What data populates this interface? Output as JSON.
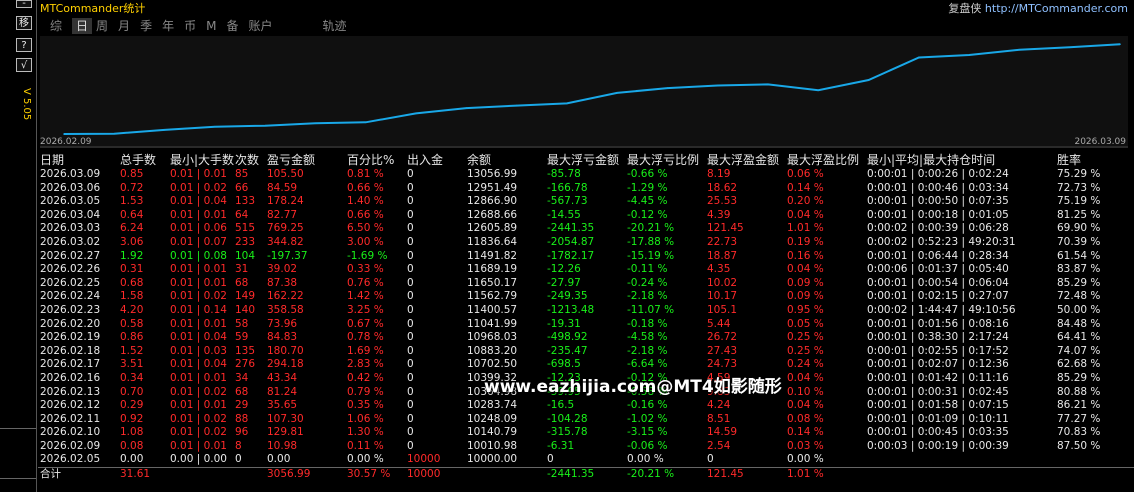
{
  "app": {
    "title": "MTCommander统计",
    "replay_label": "复盘侠",
    "replay_url": "http://MTCommander.com",
    "version": "V 5.05"
  },
  "sidebar_buttons": [
    "-",
    "移",
    "?",
    "√"
  ],
  "tabs": [
    {
      "label": "综",
      "active": false
    },
    {
      "label": "日",
      "active": true
    },
    {
      "label": "周",
      "active": false
    },
    {
      "label": "月",
      "active": false
    },
    {
      "label": "季",
      "active": false
    },
    {
      "label": "年",
      "active": false
    },
    {
      "label": "币",
      "active": false
    },
    {
      "label": "M",
      "active": false
    },
    {
      "label": "备",
      "active": false
    },
    {
      "label": "账户",
      "active": false
    },
    {
      "label": "轨迹",
      "active": false
    }
  ],
  "chart_data": {
    "type": "line",
    "x_start_label": "2026.02.09",
    "x_end_label": "2026.03.09",
    "ylim": [
      10000,
      13200
    ],
    "line_color": "#19a8e8",
    "x": [
      "2026.02.05",
      "2026.02.09",
      "2026.02.10",
      "2026.02.11",
      "2026.02.12",
      "2026.02.13",
      "2026.02.16",
      "2026.02.17",
      "2026.02.18",
      "2026.02.19",
      "2026.02.20",
      "2026.02.23",
      "2026.02.24",
      "2026.02.25",
      "2026.02.26",
      "2026.02.27",
      "2026.03.02",
      "2026.03.03",
      "2026.03.04",
      "2026.03.05",
      "2026.03.06",
      "2026.03.09"
    ],
    "values": [
      10000.0,
      10010.98,
      10140.79,
      10248.09,
      10283.74,
      10364.98,
      10399.32,
      10702.5,
      10883.2,
      10968.03,
      11041.99,
      11400.57,
      11562.79,
      11650.17,
      11689.19,
      11491.82,
      11836.64,
      12605.89,
      12688.66,
      12866.9,
      12951.49,
      13056.99
    ]
  },
  "table": {
    "headers": [
      "日期",
      "总手数",
      "最小|大手数",
      "次数",
      "盈亏金额",
      "百分比%",
      "出入金",
      "余额",
      "最大浮亏金额",
      "最大浮亏比例",
      "最大浮盈金额",
      "最大浮盈比例",
      "最小|平均|最大持仓时间",
      "胜率"
    ],
    "rows": [
      {
        "c": [
          "2026.03.09",
          "0.85",
          "0.01 | 0.01",
          "85",
          "105.50",
          "0.81 %",
          "0",
          "13056.99",
          "-85.78",
          "-0.66 %",
          "8.19",
          "0.06 %",
          "0:00:01 | 0:00:26 | 0:02:24",
          "75.29 %"
        ],
        "loss": false
      },
      {
        "c": [
          "2026.03.06",
          "0.72",
          "0.01 | 0.02",
          "66",
          "84.59",
          "0.66 %",
          "0",
          "12951.49",
          "-166.78",
          "-1.29 %",
          "18.62",
          "0.14 %",
          "0:00:01 | 0:00:46 | 0:03:34",
          "72.73 %"
        ],
        "loss": false
      },
      {
        "c": [
          "2026.03.05",
          "1.53",
          "0.01 | 0.04",
          "133",
          "178.24",
          "1.40 %",
          "0",
          "12866.90",
          "-567.73",
          "-4.45 %",
          "25.53",
          "0.20 %",
          "0:00:01 | 0:00:50 | 0:07:35",
          "75.19 %"
        ],
        "loss": false
      },
      {
        "c": [
          "2026.03.04",
          "0.64",
          "0.01 | 0.01",
          "64",
          "82.77",
          "0.66 %",
          "0",
          "12688.66",
          "-14.55",
          "-0.12 %",
          "4.39",
          "0.04 %",
          "0:00:01 | 0:00:18 | 0:01:05",
          "81.25 %"
        ],
        "loss": false
      },
      {
        "c": [
          "2026.03.03",
          "6.24",
          "0.01 | 0.06",
          "515",
          "769.25",
          "6.50 %",
          "0",
          "12605.89",
          "-2441.35",
          "-20.21 %",
          "121.45",
          "1.01 %",
          "0:00:02 | 0:00:39 | 0:06:28",
          "69.90 %"
        ],
        "loss": false
      },
      {
        "c": [
          "2026.03.02",
          "3.06",
          "0.01 | 0.07",
          "233",
          "344.82",
          "3.00 %",
          "0",
          "11836.64",
          "-2054.87",
          "-17.88 %",
          "22.73",
          "0.19 %",
          "0:00:02 | 0:52:23 | 49:20:31",
          "70.39 %"
        ],
        "loss": false
      },
      {
        "c": [
          "2026.02.27",
          "1.92",
          "0.01 | 0.08",
          "104",
          "-197.37",
          "-1.69 %",
          "0",
          "11491.82",
          "-1782.17",
          "-15.19 %",
          "18.87",
          "0.16 %",
          "0:00:01 | 0:06:44 | 0:28:34",
          "61.54 %"
        ],
        "loss": true
      },
      {
        "c": [
          "2026.02.26",
          "0.31",
          "0.01 | 0.01",
          "31",
          "39.02",
          "0.33 %",
          "0",
          "11689.19",
          "-12.26",
          "-0.11 %",
          "4.35",
          "0.04 %",
          "0:00:06 | 0:01:37 | 0:05:40",
          "83.87 %"
        ],
        "loss": false
      },
      {
        "c": [
          "2026.02.25",
          "0.68",
          "0.01 | 0.01",
          "68",
          "87.38",
          "0.76 %",
          "0",
          "11650.17",
          "-27.97",
          "-0.24 %",
          "10.02",
          "0.09 %",
          "0:00:01 | 0:00:54 | 0:06:04",
          "85.29 %"
        ],
        "loss": false
      },
      {
        "c": [
          "2026.02.24",
          "1.58",
          "0.01 | 0.02",
          "149",
          "162.22",
          "1.42 %",
          "0",
          "11562.79",
          "-249.35",
          "-2.18 %",
          "10.17",
          "0.09 %",
          "0:00:01 | 0:02:15 | 0:27:07",
          "72.48 %"
        ],
        "loss": false
      },
      {
        "c": [
          "2026.02.23",
          "4.20",
          "0.01 | 0.14",
          "140",
          "358.58",
          "3.25 %",
          "0",
          "11400.57",
          "-1213.48",
          "-11.07 %",
          "105.1",
          "0.95 %",
          "0:00:02 | 1:44:47 | 49:10:56",
          "50.00 %"
        ],
        "loss": false
      },
      {
        "c": [
          "2026.02.20",
          "0.58",
          "0.01 | 0.01",
          "58",
          "73.96",
          "0.67 %",
          "0",
          "11041.99",
          "-19.31",
          "-0.18 %",
          "5.44",
          "0.05 %",
          "0:00:01 | 0:01:56 | 0:08:16",
          "84.48 %"
        ],
        "loss": false
      },
      {
        "c": [
          "2026.02.19",
          "0.86",
          "0.01 | 0.04",
          "59",
          "84.83",
          "0.78 %",
          "0",
          "10968.03",
          "-498.92",
          "-4.58 %",
          "26.72",
          "0.25 %",
          "0:00:01 | 0:38:30 | 2:17:24",
          "64.41 %"
        ],
        "loss": false
      },
      {
        "c": [
          "2026.02.18",
          "1.52",
          "0.01 | 0.03",
          "135",
          "180.70",
          "1.69 %",
          "0",
          "10883.20",
          "-235.47",
          "-2.18 %",
          "27.43",
          "0.25 %",
          "0:00:01 | 0:02:55 | 0:17:52",
          "74.07 %"
        ],
        "loss": false
      },
      {
        "c": [
          "2026.02.17",
          "3.51",
          "0.01 | 0.04",
          "276",
          "294.18",
          "2.83 %",
          "0",
          "10702.50",
          "-698.5",
          "-6.64 %",
          "24.73",
          "0.24 %",
          "0:00:01 | 0:02:07 | 0:12:36",
          "62.68 %"
        ],
        "loss": false
      },
      {
        "c": [
          "2026.02.16",
          "0.34",
          "0.01 | 0.01",
          "34",
          "43.34",
          "0.42 %",
          "0",
          "10399.32",
          "-12.23",
          "-0.12 %",
          "4.59",
          "0.04 %",
          "0:00:01 | 0:01:42 | 0:11:16",
          "85.29 %"
        ],
        "loss": false
      },
      {
        "c": [
          "2026.02.13",
          "0.70",
          "0.01 | 0.02",
          "68",
          "81.24",
          "0.79 %",
          "0",
          "10364.98",
          "-59.95",
          "-0.58 %",
          "9.83",
          "0.10 %",
          "0:00:01 | 0:00:31 | 0:02:45",
          "80.88 %"
        ],
        "loss": false
      },
      {
        "c": [
          "2026.02.12",
          "0.29",
          "0.01 | 0.01",
          "29",
          "35.65",
          "0.35 %",
          "0",
          "10283.74",
          "-16.5",
          "-0.16 %",
          "4.24",
          "0.04 %",
          "0:00:01 | 0:01:58 | 0:07:15",
          "86.21 %"
        ],
        "loss": false
      },
      {
        "c": [
          "2026.02.11",
          "0.92",
          "0.01 | 0.02",
          "88",
          "107.30",
          "1.06 %",
          "0",
          "10248.09",
          "-104.28",
          "-1.02 %",
          "8.51",
          "0.08 %",
          "0:00:01 | 0:01:09 | 0:10:11",
          "77.27 %"
        ],
        "loss": false
      },
      {
        "c": [
          "2026.02.10",
          "1.08",
          "0.01 | 0.02",
          "96",
          "129.81",
          "1.30 %",
          "0",
          "10140.79",
          "-315.78",
          "-3.15 %",
          "14.59",
          "0.14 %",
          "0:00:01 | 0:00:45 | 0:03:35",
          "70.83 %"
        ],
        "loss": false
      },
      {
        "c": [
          "2026.02.09",
          "0.08",
          "0.01 | 0.01",
          "8",
          "10.98",
          "0.11 %",
          "0",
          "10010.98",
          "-6.31",
          "-0.06 %",
          "2.54",
          "0.03 %",
          "0:00:03 | 0:00:19 | 0:00:39",
          "87.50 %"
        ],
        "loss": false
      },
      {
        "c": [
          "2026.02.05",
          "0.00",
          "0.00 | 0.00",
          "0",
          "0.00",
          "0.00 %",
          "10000",
          "10000.00",
          "0",
          "0.00 %",
          "0",
          "0.00 %",
          "",
          ""
        ],
        "loss": false
      }
    ],
    "total": [
      "合计",
      "31.61",
      "",
      "",
      "3056.99",
      "30.57 %",
      "10000",
      "",
      "-2441.35",
      "-20.21 %",
      "121.45",
      "1.01 %",
      "",
      ""
    ]
  },
  "watermark": "www.eazhijia.com@MT4如影随形"
}
